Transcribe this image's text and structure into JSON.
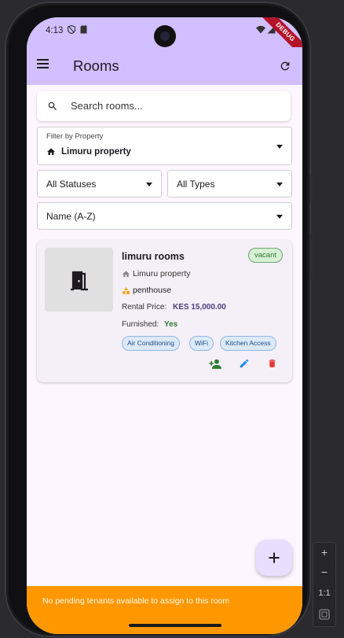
{
  "status_bar": {
    "time": "4:13",
    "debug_label": "DEBUG"
  },
  "app_bar": {
    "title": "Rooms",
    "menu_icon": "menu-icon",
    "refresh_icon": "refresh-icon"
  },
  "search": {
    "placeholder": "Search rooms..."
  },
  "filters": {
    "property": {
      "label": "Filter by Property",
      "value": "Limuru property"
    },
    "status": {
      "value": "All Statuses"
    },
    "type": {
      "value": "All Types"
    },
    "sort": {
      "value": "Name (A-Z)"
    }
  },
  "room_card": {
    "name": "limuru rooms",
    "status_badge": "vacant",
    "property": "Limuru property",
    "room_type": "penthouse",
    "rental_price_label": "Rental Price:",
    "rental_price": "KES 15,000.00",
    "furnished_label": "Furnished:",
    "furnished": "Yes",
    "amenities": [
      "Air Conditioning",
      "WiFi",
      "Kitchen Access"
    ]
  },
  "snackbar": {
    "message": "No pending tenants available to assign to this room"
  },
  "emulator": {
    "zoom_in": "+",
    "zoom_out": "−",
    "ratio": "1:1"
  },
  "colors": {
    "app_bar": "#d1bfff",
    "background": "#fdf6ff",
    "badge_green": "#2e7d32",
    "snackbar": "#ff9800",
    "delete_red": "#e53935",
    "edit_blue": "#1e88e5"
  }
}
